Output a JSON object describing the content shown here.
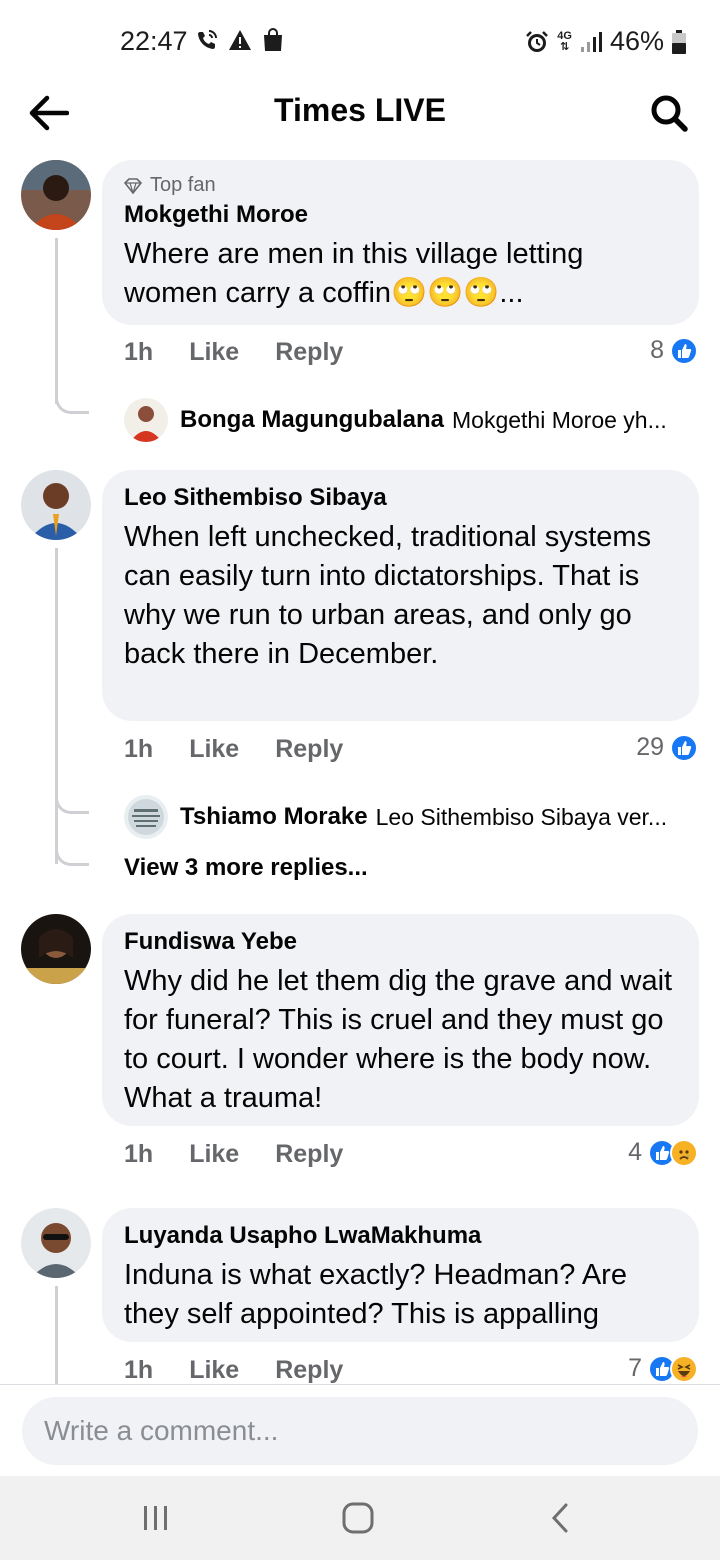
{
  "status_bar": {
    "time": "22:47",
    "network": "4G",
    "battery": "46%"
  },
  "header": {
    "title": "Times LIVE"
  },
  "comments": [
    {
      "badge": "Top fan",
      "author": "Mokgethi Moroe",
      "text": "Where are men in this village letting women carry a coffin🙄🙄🙄...",
      "time": "1h",
      "like_label": "Like",
      "reply_label": "Reply",
      "reaction_count": "8",
      "reply_preview": {
        "author": "Bonga Magungubalana",
        "text": "Mokgethi Moroe yh..."
      }
    },
    {
      "author": "Leo Sithembiso Sibaya",
      "text": "When left unchecked, traditional systems can easily turn into dictatorships. That is why we run to urban areas, and only go back there in December.",
      "time": "1h",
      "like_label": "Like",
      "reply_label": "Reply",
      "reaction_count": "29",
      "reply_preview": {
        "author": "Tshiamo Morake",
        "text": "Leo Sithembiso Sibaya ver..."
      },
      "more_replies": "View 3 more replies..."
    },
    {
      "author": "Fundiswa Yebe",
      "text": "Why did he let them dig the grave and wait for funeral? This is cruel and they must go to court. I wonder where is the body now. What a  trauma!",
      "time": "1h",
      "like_label": "Like",
      "reply_label": "Reply",
      "reaction_count": "4"
    },
    {
      "author": "Luyanda Usapho LwaMakhuma",
      "text": "Induna is what exactly? Headman? Are they self appointed? This is appalling",
      "time": "1h",
      "like_label": "Like",
      "reply_label": "Reply",
      "reaction_count": "7"
    }
  ],
  "composer": {
    "placeholder": "Write a comment..."
  },
  "colors": {
    "like_blue": "#1877f2",
    "bubble_bg": "#f0f2f5",
    "meta_gray": "#65676b"
  }
}
